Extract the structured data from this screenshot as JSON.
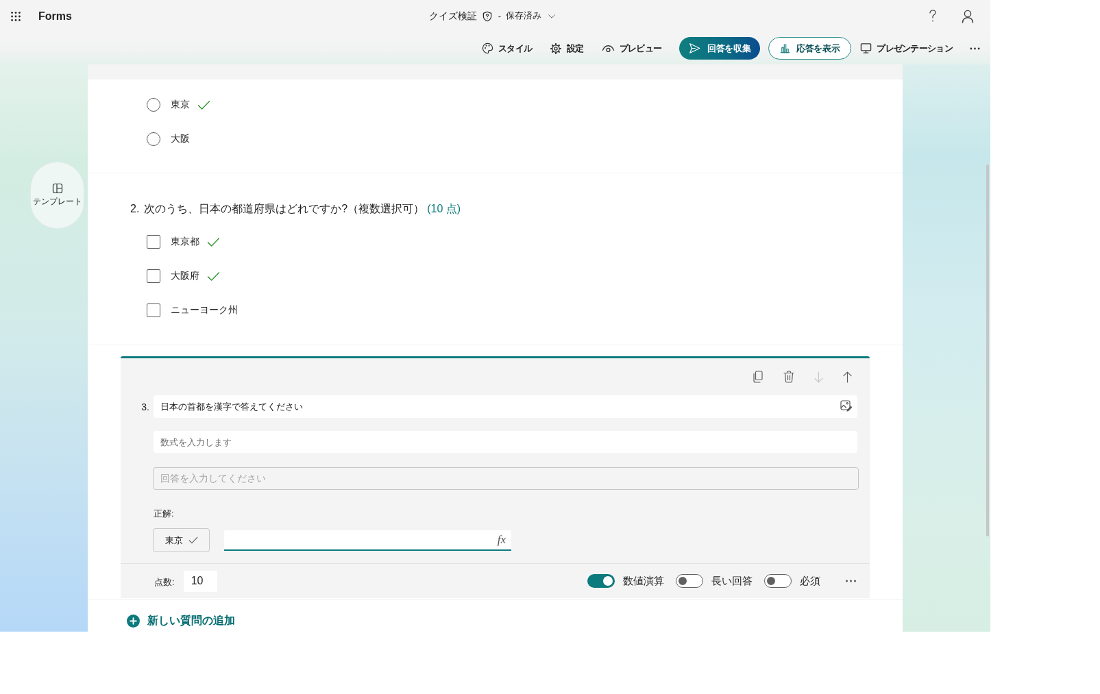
{
  "app_bar": {
    "app_name": "Forms",
    "form_title": "クイズ検証",
    "separator": "-",
    "save_status": "保存済み"
  },
  "toolbar": {
    "style": "スタイル",
    "settings": "設定",
    "preview": "プレビュー",
    "collect": "回答を収集",
    "responses": "応答を表示",
    "present": "プレゼンテーション"
  },
  "side_panel": {
    "template_button": "テンプレート"
  },
  "questions": [
    {
      "kind": "single_choice",
      "options": [
        {
          "label": "東京",
          "checked": false,
          "correct": true
        },
        {
          "label": "大阪",
          "checked": false,
          "correct": false
        }
      ]
    },
    {
      "kind": "multiple_choice",
      "number": "2.",
      "title": "次のうち、日本の都道府県はどれですか?（複数選択可）",
      "points": "(10 点)",
      "options": [
        {
          "label": "東京都",
          "checked": false,
          "correct": true
        },
        {
          "label": "大阪府",
          "checked": false,
          "correct": true
        },
        {
          "label": "ニューヨーク州",
          "checked": false,
          "correct": false
        }
      ]
    },
    {
      "kind": "editor",
      "number": "3.",
      "actions": [
        {
          "kind": "copy",
          "disabled": false
        },
        {
          "kind": "delete",
          "disabled": false
        },
        {
          "kind": "move_down",
          "disabled": true
        },
        {
          "kind": "move_up",
          "disabled": false
        }
      ],
      "title": "日本の首都を漢字で答えてください",
      "formula_placeholder": "数式を入力します",
      "answer_placeholder": "回答を入力してください",
      "correct_label": "正解:",
      "correct_answers": [
        "東京"
      ],
      "formula_button": "fx",
      "points_label": "点数:",
      "points": "10",
      "toggles": [
        {
          "label": "数値演算",
          "on": true
        },
        {
          "label": "長い回答",
          "on": false
        },
        {
          "label": "必須",
          "on": false
        }
      ]
    }
  ],
  "add_question": "新しい質問の追加"
}
